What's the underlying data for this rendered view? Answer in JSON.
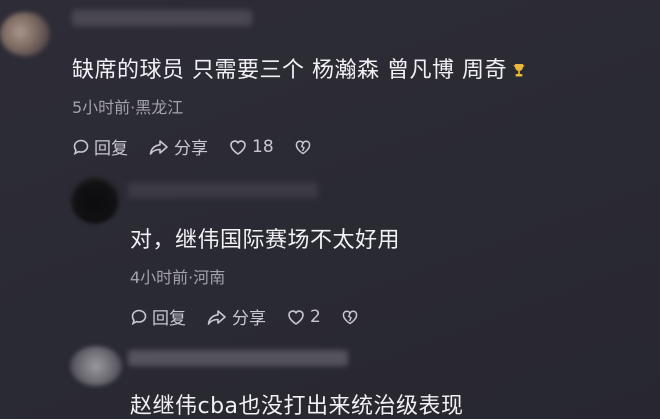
{
  "comments": [
    {
      "text": "缺席的球员 只需要三个 杨瀚森 曾凡博 周奇",
      "meta": "5小时前·黑龙江",
      "reply_label": "回复",
      "share_label": "分享",
      "like_count": "18"
    },
    {
      "text": "对，继伟国际赛场不太好用",
      "meta": "4小时前·河南",
      "reply_label": "回复",
      "share_label": "分享",
      "like_count": "2"
    },
    {
      "text": "赵继伟cba也没打出来统治级表现"
    }
  ],
  "icons": {
    "reply": "reply-bubble-icon",
    "share": "share-arrow-icon",
    "like": "heart-icon",
    "dislike": "broken-heart-icon",
    "badge": "trophy-icon"
  },
  "colors": {
    "background": "#2b2a33",
    "text": "#f1f1f5",
    "meta": "#a3a2ac",
    "badge": "#e8b83a"
  }
}
